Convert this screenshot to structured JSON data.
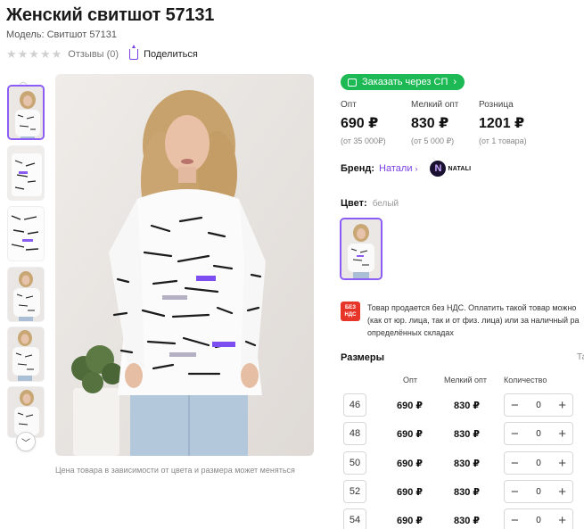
{
  "product": {
    "title": "Женский свитшот 57131",
    "model": "Модель: Свитшот 57131",
    "reviews": "Отзывы (0)",
    "share": "Поделиться",
    "rating_stars": 0
  },
  "gallery": {
    "thumbnail_count": 6,
    "active_index": 0,
    "caption": "Цена товара в зависимости от цвета и размера может меняться"
  },
  "order": {
    "sp_button": "Заказать через СП",
    "accent_color": "#1db954"
  },
  "prices": [
    {
      "label": "Опт",
      "value": "690 ₽",
      "note": "(от 35 000₽)"
    },
    {
      "label": "Мелкий опт",
      "value": "830 ₽",
      "note": "(от 5 000 ₽)"
    },
    {
      "label": "Розница",
      "value": "1201 ₽",
      "note": "(от 1 товара)"
    }
  ],
  "brand": {
    "label": "Бренд:",
    "name": "Натали",
    "logo_letter": "N",
    "logo_text": "NATALI"
  },
  "color": {
    "label": "Цвет:",
    "value": "белый"
  },
  "vat": {
    "badge_line1": "БЕЗ",
    "badge_line2": "НДС",
    "line1": "Товар продается без НДС. Оплатить такой товар можно",
    "line2": "(как от юр. лица, так и от физ. лица) или за наличный ра",
    "line3": "определённых складах"
  },
  "sizes": {
    "title": "Размеры",
    "table_link": "Та",
    "headers": {
      "opt": "Опт",
      "small_opt": "Мелкий опт",
      "qty": "Количество"
    },
    "rows": [
      {
        "size": "46",
        "opt": "690 ₽",
        "small_opt": "830 ₽",
        "qty": "0"
      },
      {
        "size": "48",
        "opt": "690 ₽",
        "small_opt": "830 ₽",
        "qty": "0"
      },
      {
        "size": "50",
        "opt": "690 ₽",
        "small_opt": "830 ₽",
        "qty": "0"
      },
      {
        "size": "52",
        "opt": "690 ₽",
        "small_opt": "830 ₽",
        "qty": "0"
      },
      {
        "size": "54",
        "opt": "690 ₽",
        "small_opt": "830 ₽",
        "qty": "0"
      }
    ]
  }
}
